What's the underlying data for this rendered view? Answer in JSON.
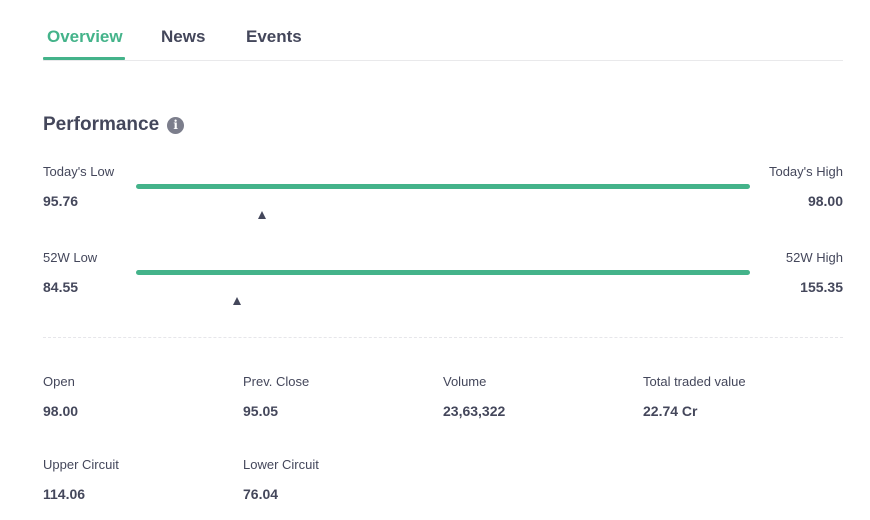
{
  "tabs": [
    {
      "label": "Overview",
      "active": true
    },
    {
      "label": "News",
      "active": false
    },
    {
      "label": "Events",
      "active": false
    }
  ],
  "performance": {
    "title": "Performance",
    "info_icon": "info-icon",
    "todays_range": {
      "low_label": "Today's Low",
      "low_value": "95.76",
      "high_label": "Today's High",
      "high_value": "98.00",
      "marker_fraction": 0.205
    },
    "week52_range": {
      "low_label": "52W Low",
      "low_value": "84.55",
      "high_label": "52W High",
      "high_value": "155.35",
      "marker_fraction": 0.165
    }
  },
  "stats": [
    {
      "label": "Open",
      "value": "98.00"
    },
    {
      "label": "Prev. Close",
      "value": "95.05"
    },
    {
      "label": "Volume",
      "value": "23,63,322"
    },
    {
      "label": "Total traded value",
      "value": "22.74 Cr"
    },
    {
      "label": "Upper Circuit",
      "value": "114.06"
    },
    {
      "label": "Lower Circuit",
      "value": "76.04"
    }
  ],
  "colors": {
    "accent": "#44b38a",
    "text": "#44475b",
    "muted_icon": "#7c7e8c",
    "divider": "#e9e9eb"
  }
}
